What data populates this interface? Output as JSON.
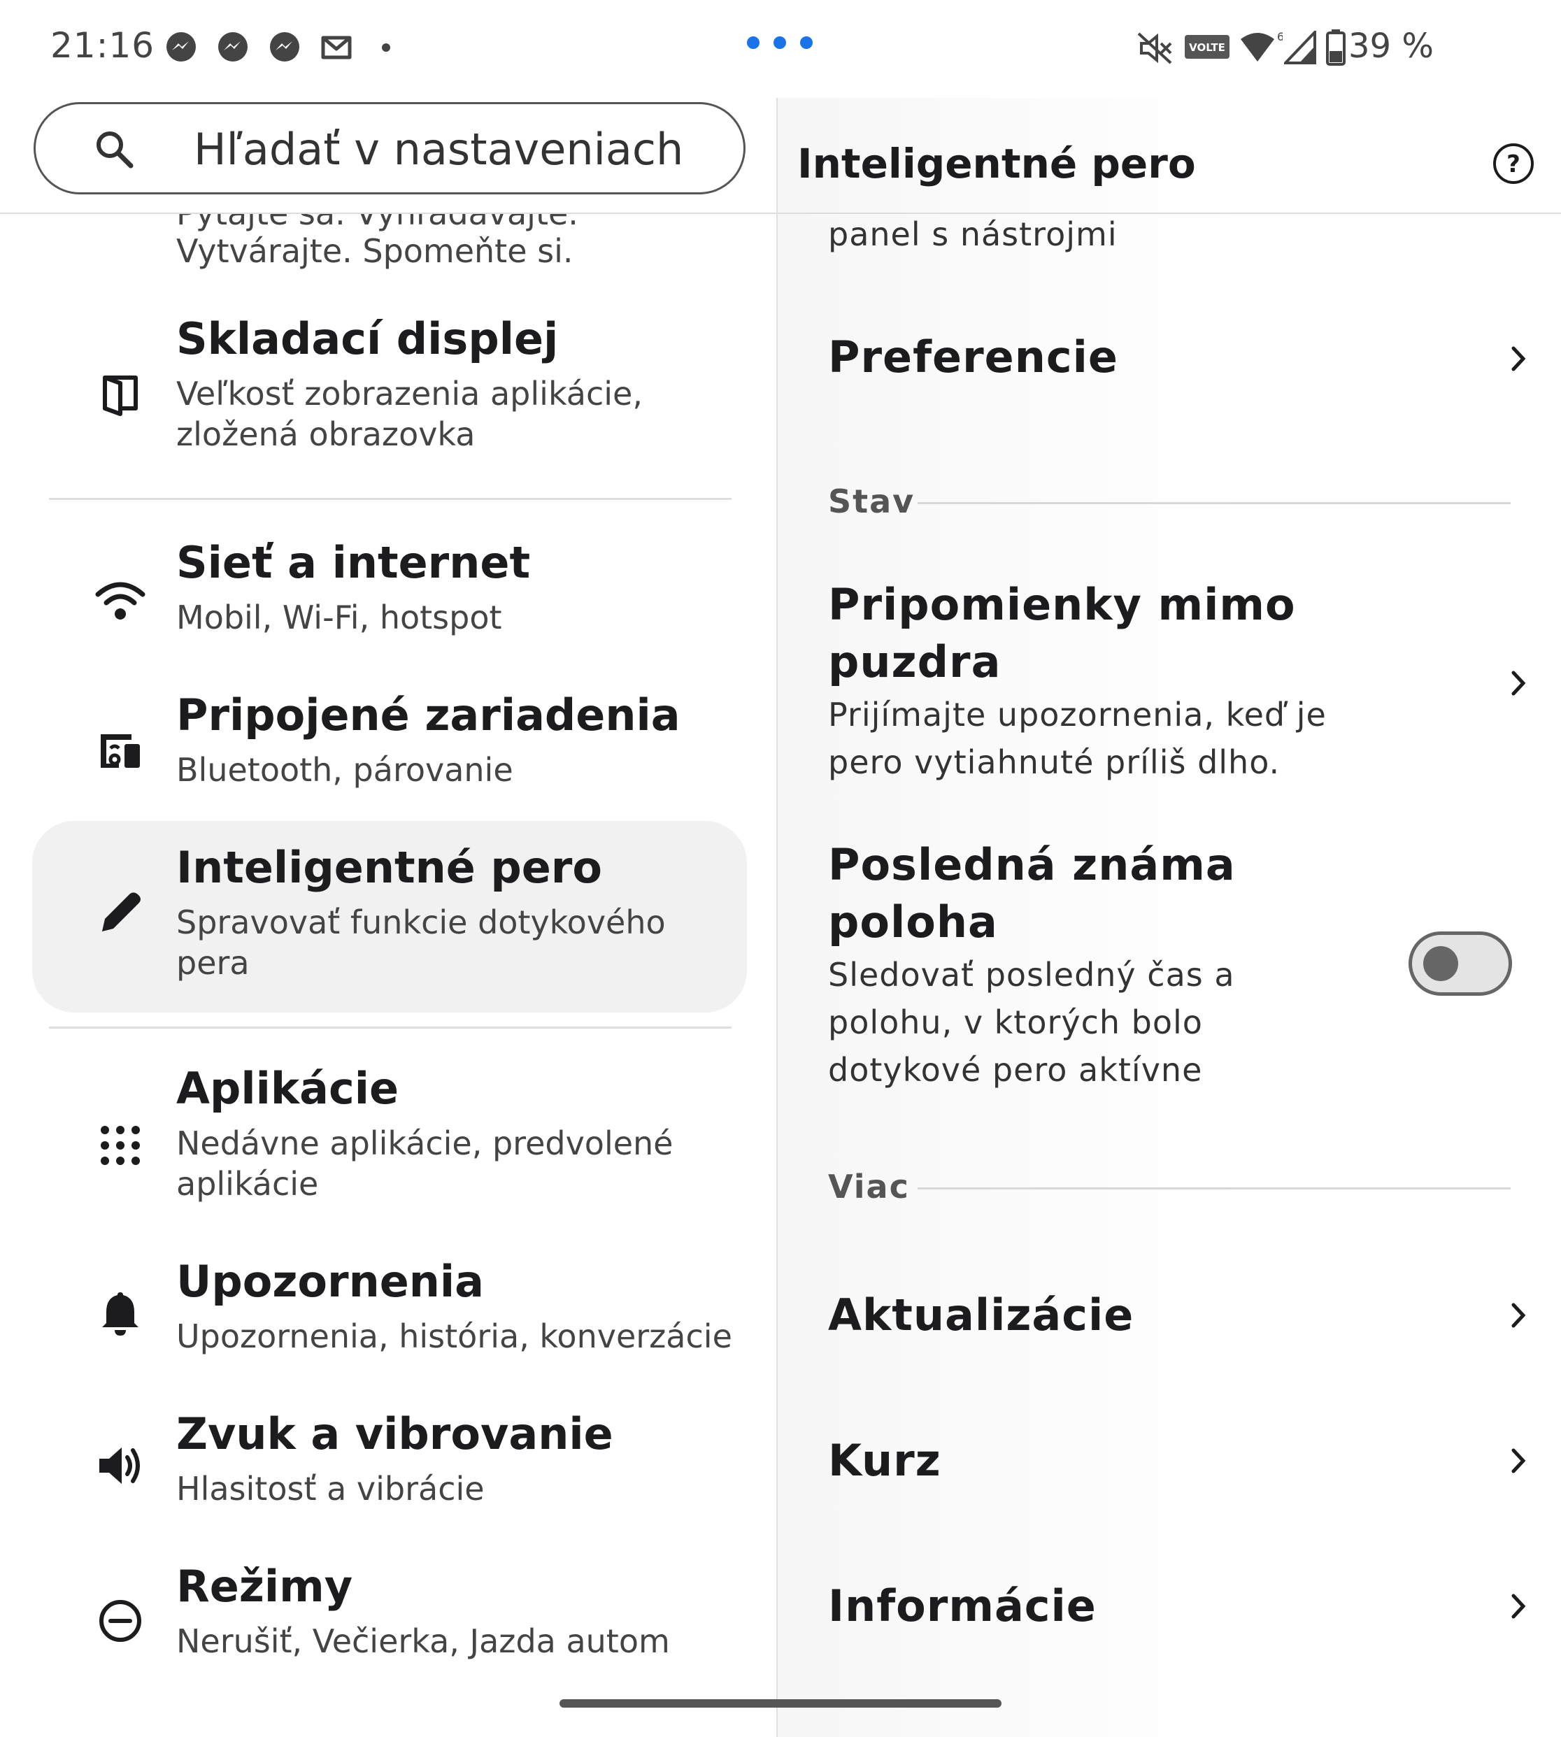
{
  "status_bar": {
    "time": "21:16",
    "notification_icons": [
      "messenger-icon",
      "messenger-icon",
      "messenger-icon",
      "gmail-icon"
    ],
    "right_icons": [
      "mute-icon",
      "volte-icon",
      "wifi-icon",
      "signal-icon",
      "battery-icon"
    ],
    "volte_label": "VOLTE",
    "wifi_badge": "6",
    "battery_text": "39 %",
    "accent_color": "#1a73e8"
  },
  "search": {
    "placeholder": "Hľadať v nastaveniach"
  },
  "left_list": {
    "cut_top_title": "Pýtajte sa. Vyhľadávajte.",
    "cut_top_subtitle": "Vytvárajte. Spomeňte si.",
    "items": [
      {
        "icon": "foldable-display-icon",
        "title": "Skladací displej",
        "subtitle": "Veľkosť zobrazenia aplikácie, zložená obrazovka"
      },
      {
        "icon": "wifi-icon",
        "title": "Sieť a internet",
        "subtitle": "Mobil, Wi‑Fi, hotspot"
      },
      {
        "icon": "connected-devices-icon",
        "title": "Pripojené zariadenia",
        "subtitle": "Bluetooth, párovanie"
      },
      {
        "icon": "pen-icon",
        "title": "Inteligentné pero",
        "subtitle": "Spravovať funkcie dotykového pera",
        "selected": true
      },
      {
        "icon": "apps-grid-icon",
        "title": "Aplikácie",
        "subtitle": "Nedávne aplikácie, predvolené aplikácie"
      },
      {
        "icon": "bell-icon",
        "title": "Upozornenia",
        "subtitle": "Upozornenia, história, konverzácie"
      },
      {
        "icon": "speaker-icon",
        "title": "Zvuk a vibrovanie",
        "subtitle": "Hlasitosť a vibrácie"
      },
      {
        "icon": "do-not-disturb-icon",
        "title": "Režimy",
        "subtitle": "Nerušiť, Večierka, Jazda autom"
      }
    ]
  },
  "detail": {
    "title": "Inteligentné pero",
    "cut_top_text": "panel s nástrojmi",
    "preferences": "Preferencie",
    "section_status": "Stav",
    "reminders_title": "Pripomienky mimo puzdra",
    "reminders_subtitle": "Prijímajte upozornenia, keď je pero vytiahnuté príliš dlho.",
    "last_location_title": "Posledná známa poloha",
    "last_location_subtitle": "Sledovať posledný čas a polohu, v ktorých bolo dotykové pero aktívne",
    "last_location_enabled": false,
    "section_more": "Viac",
    "updates": "Aktualizácie",
    "course": "Kurz",
    "info": "Informácie"
  }
}
